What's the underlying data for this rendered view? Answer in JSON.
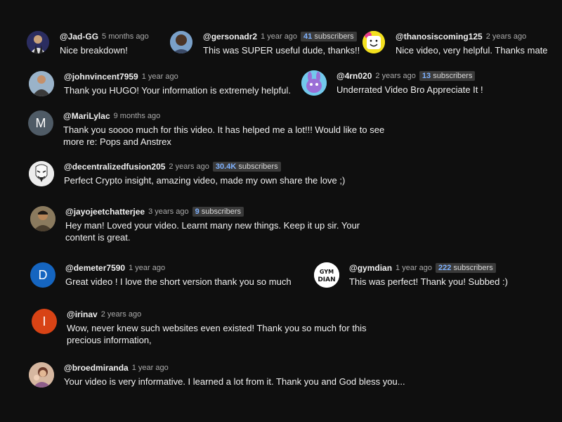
{
  "comments": [
    {
      "handle": "@Jad-GG",
      "time": "5 months ago",
      "subs_count": "",
      "subs_label": "",
      "text": "Nice breakdown!",
      "avatar": "photo-avatar"
    },
    {
      "handle": "@gersonadr2",
      "time": "1 year ago",
      "subs_count": "41",
      "subs_label": "subscribers",
      "text": "This was SUPER useful dude, thanks!!",
      "avatar": "photo-avatar"
    },
    {
      "handle": "@thanosiscoming125",
      "time": "2 years ago",
      "subs_count": "",
      "subs_label": "",
      "text": "Nice video, very helpful. Thanks mate",
      "avatar": "marshmello-avatar"
    },
    {
      "handle": "@johnvincent7959",
      "time": "1 year ago",
      "subs_count": "",
      "subs_label": "",
      "text": "Thank you HUGO! Your information is extremely helpful.",
      "avatar": "photo-avatar"
    },
    {
      "handle": "@4rn020",
      "time": "2 years ago",
      "subs_count": "13",
      "subs_label": "subscribers",
      "text": "Underrated Video Bro Appreciate It !",
      "avatar": "photo-avatar"
    },
    {
      "handle": "@MariLylac",
      "time": "9 months ago",
      "subs_count": "",
      "subs_label": "",
      "text": "Thank you soooo much for this video. It has helped me a lot!!! Would like to see more re: Pops and Anstrex",
      "avatar": "letter-avatar",
      "letter": "M",
      "color": "#4f5b66"
    },
    {
      "handle": "@decentralizedfusion205",
      "time": "2 years ago",
      "subs_count": "30.4K",
      "subs_label": "subscribers",
      "text": "Perfect Crypto insight, amazing video, made my own share the love ;)",
      "avatar": "mask-avatar"
    },
    {
      "handle": "@jayojeetchatterjee",
      "time": "3 years ago",
      "subs_count": "9",
      "subs_label": "subscribers",
      "text": "Hey man! Loved your video. Learnt many new things. Keep it up sir. Your content is great.",
      "avatar": "photo-avatar"
    },
    {
      "handle": "@demeter7590",
      "time": "1 year ago",
      "subs_count": "",
      "subs_label": "",
      "text": "Great video ! I love the short version thank you so much",
      "avatar": "letter-avatar",
      "letter": "D",
      "color": "#1565c0"
    },
    {
      "handle": "@gymdian",
      "time": "1 year ago",
      "subs_count": "222",
      "subs_label": "subscribers",
      "text": "This was perfect! Thank you! Subbed :)",
      "avatar": "logo-avatar",
      "logo_text": "GYM DIAN"
    },
    {
      "handle": "@irinav",
      "time": "2 years ago",
      "subs_count": "",
      "subs_label": "",
      "text": "Wow, never knew such websites even existed! Thank you so much for this precious information,",
      "avatar": "letter-avatar",
      "letter": "I",
      "color": "#d84315"
    },
    {
      "handle": "@broedmiranda",
      "time": "1 year ago",
      "subs_count": "",
      "subs_label": "",
      "text": "Your video is very informative. I learned a lot from it. Thank you and God bless you...",
      "avatar": "photo-avatar"
    }
  ],
  "colors": {
    "background": "#0f0f0f",
    "text": "#f1f1f1",
    "muted": "#aaaaaa",
    "badge_bg": "#3a3a3a",
    "badge_count": "#7fb2ff"
  }
}
